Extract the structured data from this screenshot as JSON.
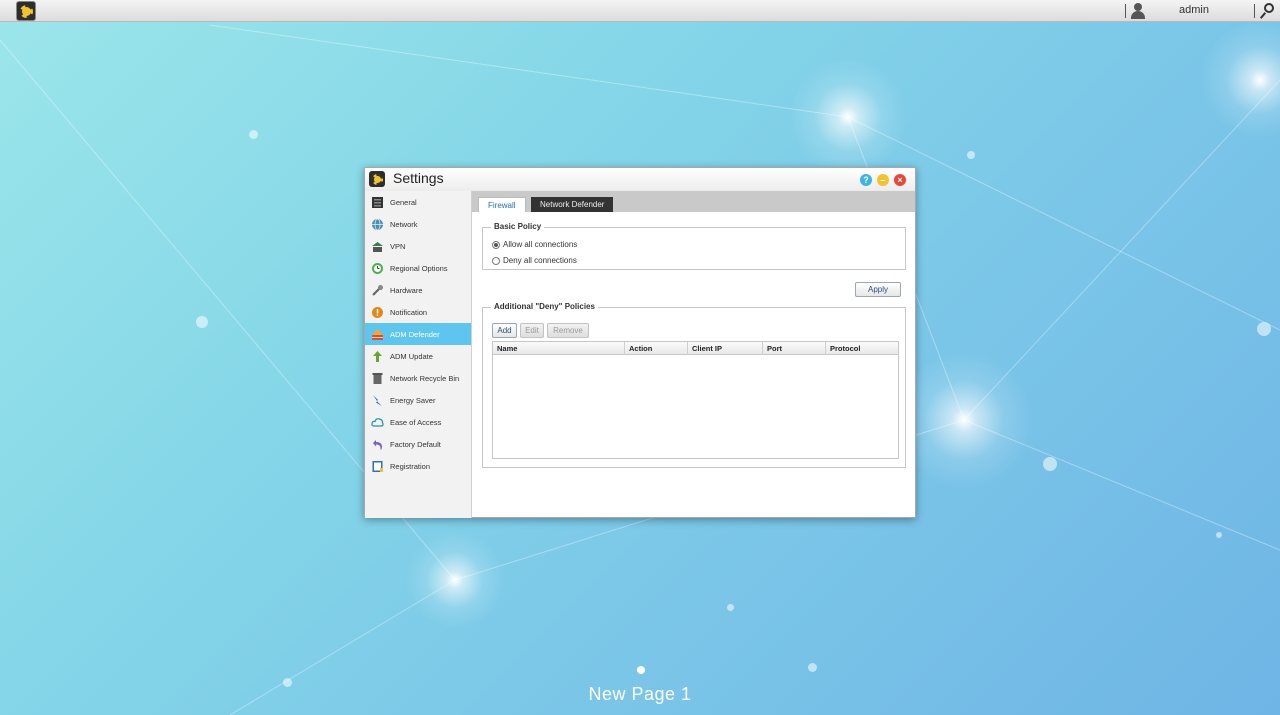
{
  "taskbar": {
    "username": "admin"
  },
  "window": {
    "title": "Settings",
    "buttons": {
      "help": "?",
      "minimize": "–",
      "close": "×"
    }
  },
  "sidebar": {
    "items": [
      {
        "label": "General",
        "icon": "server-icon"
      },
      {
        "label": "Network",
        "icon": "globe-icon"
      },
      {
        "label": "VPN",
        "icon": "vpn-icon"
      },
      {
        "label": "Regional Options",
        "icon": "clock-icon"
      },
      {
        "label": "Hardware",
        "icon": "wrench-icon"
      },
      {
        "label": "Notification",
        "icon": "alert-icon"
      },
      {
        "label": "ADM Defender",
        "icon": "firewall-icon"
      },
      {
        "label": "ADM Update",
        "icon": "update-arrow-icon"
      },
      {
        "label": "Network Recycle Bin",
        "icon": "trash-icon"
      },
      {
        "label": "Energy Saver",
        "icon": "lightning-icon"
      },
      {
        "label": "Ease of Access",
        "icon": "cloud-icon"
      },
      {
        "label": "Factory Default",
        "icon": "undo-icon"
      },
      {
        "label": "Registration",
        "icon": "clipboard-icon"
      }
    ],
    "active_index": 6
  },
  "tabs": {
    "firewall": "Firewall",
    "network_defender": "Network Defender"
  },
  "basic_policy": {
    "title": "Basic Policy",
    "options": [
      {
        "label": "Allow all connections",
        "checked": true
      },
      {
        "label": "Deny all connections",
        "checked": false
      }
    ]
  },
  "apply_label": "Apply",
  "deny_policies": {
    "title": "Additional \"Deny\" Policies",
    "buttons": {
      "add": "Add",
      "edit": "Edit",
      "remove": "Remove"
    },
    "columns": [
      "Name",
      "Action",
      "Client IP",
      "Port",
      "Protocol"
    ],
    "rows": []
  },
  "desktop": {
    "page_label": "New Page 1"
  },
  "colors": {
    "active_item": "#5ec6ee",
    "help_button": "#3bb4e0",
    "minimize_button": "#f2c230",
    "close_button": "#e8473c"
  }
}
